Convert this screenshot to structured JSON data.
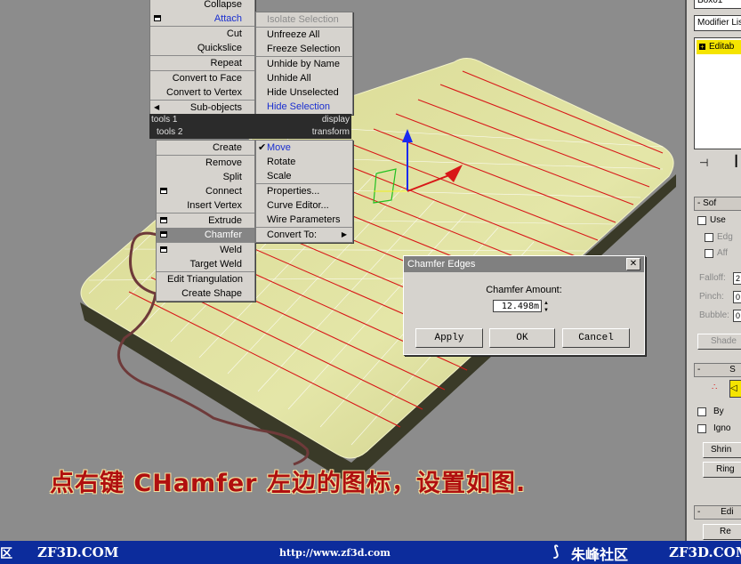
{
  "menu_left_top": [
    "Collapse",
    "Attach",
    "Cut",
    "Quickslice",
    "Repeat",
    "Convert to Face",
    "Convert to Vertex",
    "Sub-objects"
  ],
  "quad_labels": {
    "tools1": "tools 1",
    "display": "display",
    "tools2": "tools 2",
    "transform": "transform"
  },
  "menu_right_top": [
    "Isolate Selection",
    "Unfreeze All",
    "Freeze Selection",
    "Unhide by Name",
    "Unhide All",
    "Hide Unselected",
    "Hide Selection"
  ],
  "menu_left_bottom": [
    "Create",
    "Remove",
    "Split",
    "Connect",
    "Insert Vertex",
    "Extrude",
    "Chamfer",
    "Weld",
    "Target Weld",
    "Edit Triangulation",
    "Create Shape"
  ],
  "menu_right_bottom": [
    "Move",
    "Rotate",
    "Scale",
    "Properties...",
    "Curve Editor...",
    "Wire Parameters",
    "Convert To:"
  ],
  "dialog": {
    "title": "Chamfer Edges",
    "label": "Chamfer Amount:",
    "value": "12.498m",
    "apply": "Apply",
    "ok": "OK",
    "cancel": "Cancel",
    "close": "✕"
  },
  "right_panel": {
    "object_name": "Box01",
    "modifier_list": "Modifier Lis",
    "stack_item": "Editab",
    "plus": "+",
    "soft_sel": "Sof",
    "use": "Use",
    "edge": "Edg",
    "affect": "Aff",
    "falloff": "Falloff:",
    "falloff_val": "2",
    "pinch": "Pinch:",
    "pinch_val": "0",
    "bubble": "Bubble:",
    "bubble_val": "0",
    "shaded": "Shade",
    "selection": "S",
    "by": "By",
    "ignore": "Igno",
    "shrink": "Shrin",
    "ring": "Ring",
    "edit": "Edi",
    "re": "Re"
  },
  "caption": "点右键 CHamfer 左边的图标，设置如图.",
  "footer": {
    "left_char": "区",
    "brand1": "ZF3D.COM",
    "url": "http://www.zf3d.com",
    "community": "朱峰社区",
    "brand2": "ZF3D.COM"
  },
  "colors": {
    "viewport": "#8c8c8c",
    "mesh": "#d8d896",
    "menu": "#d6d3ce",
    "highlight": "#858585",
    "footer": "#0c2c9c",
    "caption": "#b00f0f"
  }
}
